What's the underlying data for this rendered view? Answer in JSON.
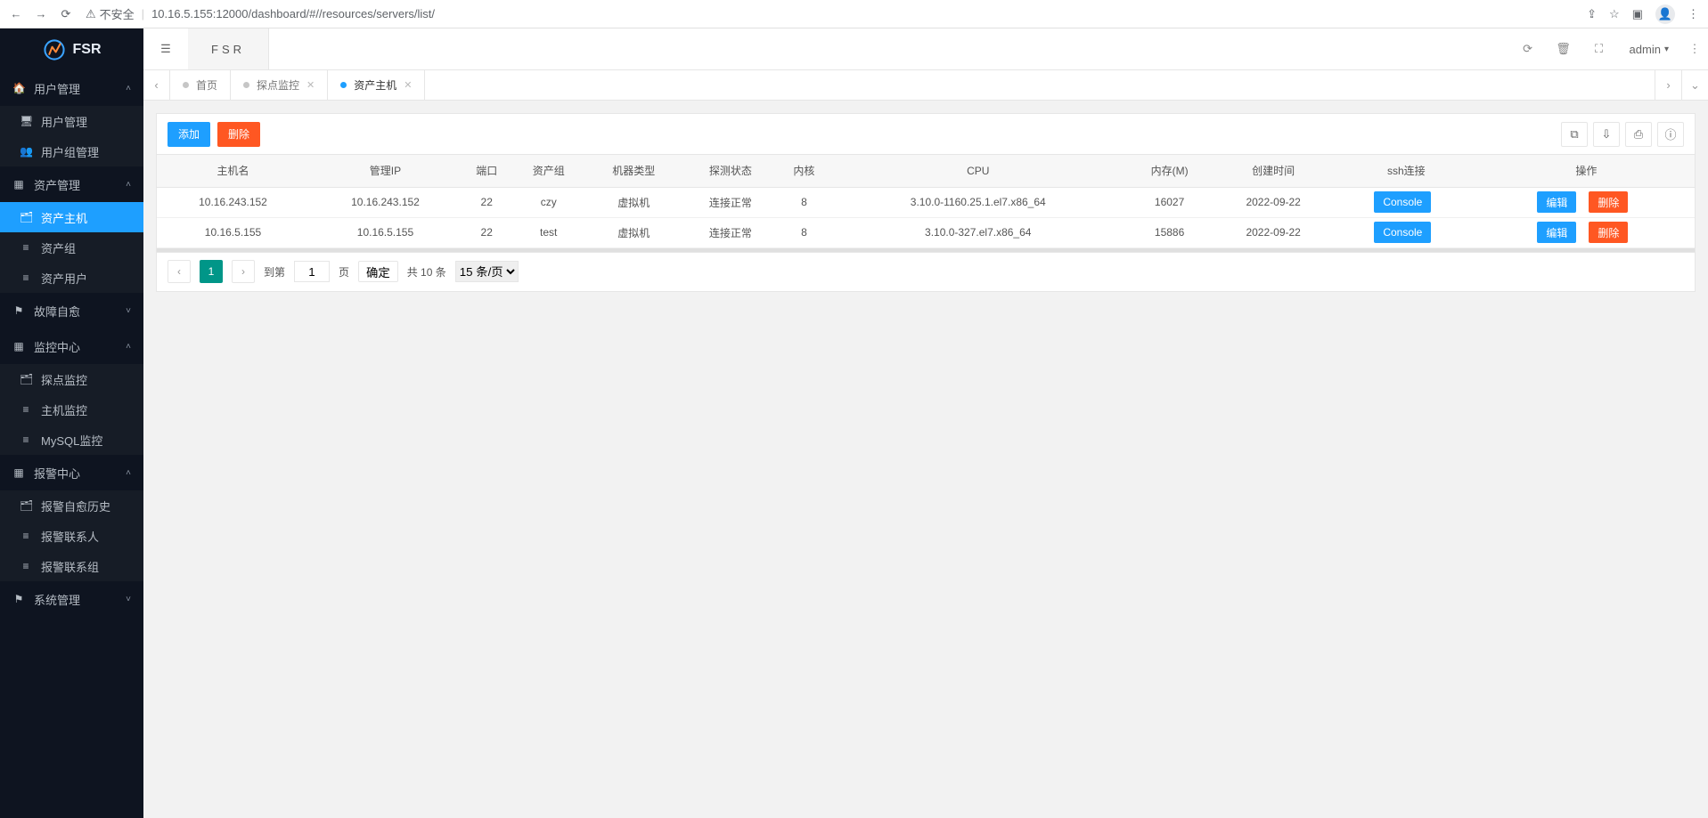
{
  "chrome": {
    "insecure_label": "不安全",
    "url": "10.16.5.155:12000/dashboard/#//resources/servers/list/"
  },
  "brand": "FSR",
  "topbar": {
    "app_tab": "FSR",
    "user": "admin"
  },
  "sidebar": {
    "groups": [
      {
        "label": "用户管理",
        "icon": "🏠",
        "open": true,
        "items": [
          {
            "icon": "🖥",
            "label": "用户管理"
          },
          {
            "icon": "👥",
            "label": "用户组管理"
          }
        ]
      },
      {
        "label": "资产管理",
        "icon": "▦",
        "open": true,
        "items": [
          {
            "icon": "🗂",
            "label": "资产主机",
            "active": true
          },
          {
            "icon": "≡",
            "label": "资产组"
          },
          {
            "icon": "≡",
            "label": "资产用户"
          }
        ]
      },
      {
        "label": "故障自愈",
        "icon": "⚑",
        "open": false,
        "items": []
      },
      {
        "label": "监控中心",
        "icon": "▦",
        "open": true,
        "items": [
          {
            "icon": "🗂",
            "label": "探点监控"
          },
          {
            "icon": "≡",
            "label": "主机监控"
          },
          {
            "icon": "≡",
            "label": "MySQL监控"
          }
        ]
      },
      {
        "label": "报警中心",
        "icon": "▦",
        "open": true,
        "items": [
          {
            "icon": "🗂",
            "label": "报警自愈历史"
          },
          {
            "icon": "≡",
            "label": "报警联系人"
          },
          {
            "icon": "≡",
            "label": "报警联系组"
          }
        ]
      },
      {
        "label": "系统管理",
        "icon": "⚑",
        "open": false,
        "items": []
      }
    ]
  },
  "tabs": [
    {
      "label": "首页",
      "active": false,
      "closable": false
    },
    {
      "label": "探点监控",
      "active": false,
      "closable": true
    },
    {
      "label": "资产主机",
      "active": true,
      "closable": true
    }
  ],
  "toolbar": {
    "add_label": "添加",
    "delete_label": "删除"
  },
  "table": {
    "columns": [
      "主机名",
      "管理IP",
      "端口",
      "资产组",
      "机器类型",
      "探测状态",
      "内核",
      "CPU",
      "内存(M)",
      "创建时间",
      "ssh连接",
      "操作"
    ],
    "rows": [
      {
        "host": "10.16.243.152",
        "ip": "10.16.243.152",
        "port": "22",
        "group": "czy",
        "type": "虚拟机",
        "status": "连接正常",
        "kernel": "8",
        "cpu": "3.10.0-1160.25.1.el7.x86_64",
        "mem": "16027",
        "created": "2022-09-22",
        "ssh": "Console"
      },
      {
        "host": "10.16.5.155",
        "ip": "10.16.5.155",
        "port": "22",
        "group": "test",
        "type": "虚拟机",
        "status": "连接正常",
        "kernel": "8",
        "cpu": "3.10.0-327.el7.x86_64",
        "mem": "15886",
        "created": "2022-09-22",
        "ssh": "Console"
      }
    ],
    "row_action_edit": "编辑",
    "row_action_delete": "删除"
  },
  "pagination": {
    "current_page": "1",
    "goto_label": "到第",
    "page_input": "1",
    "page_unit": "页",
    "confirm_label": "确定",
    "total_label": "共 10 条",
    "size_label": "15 条/页"
  }
}
